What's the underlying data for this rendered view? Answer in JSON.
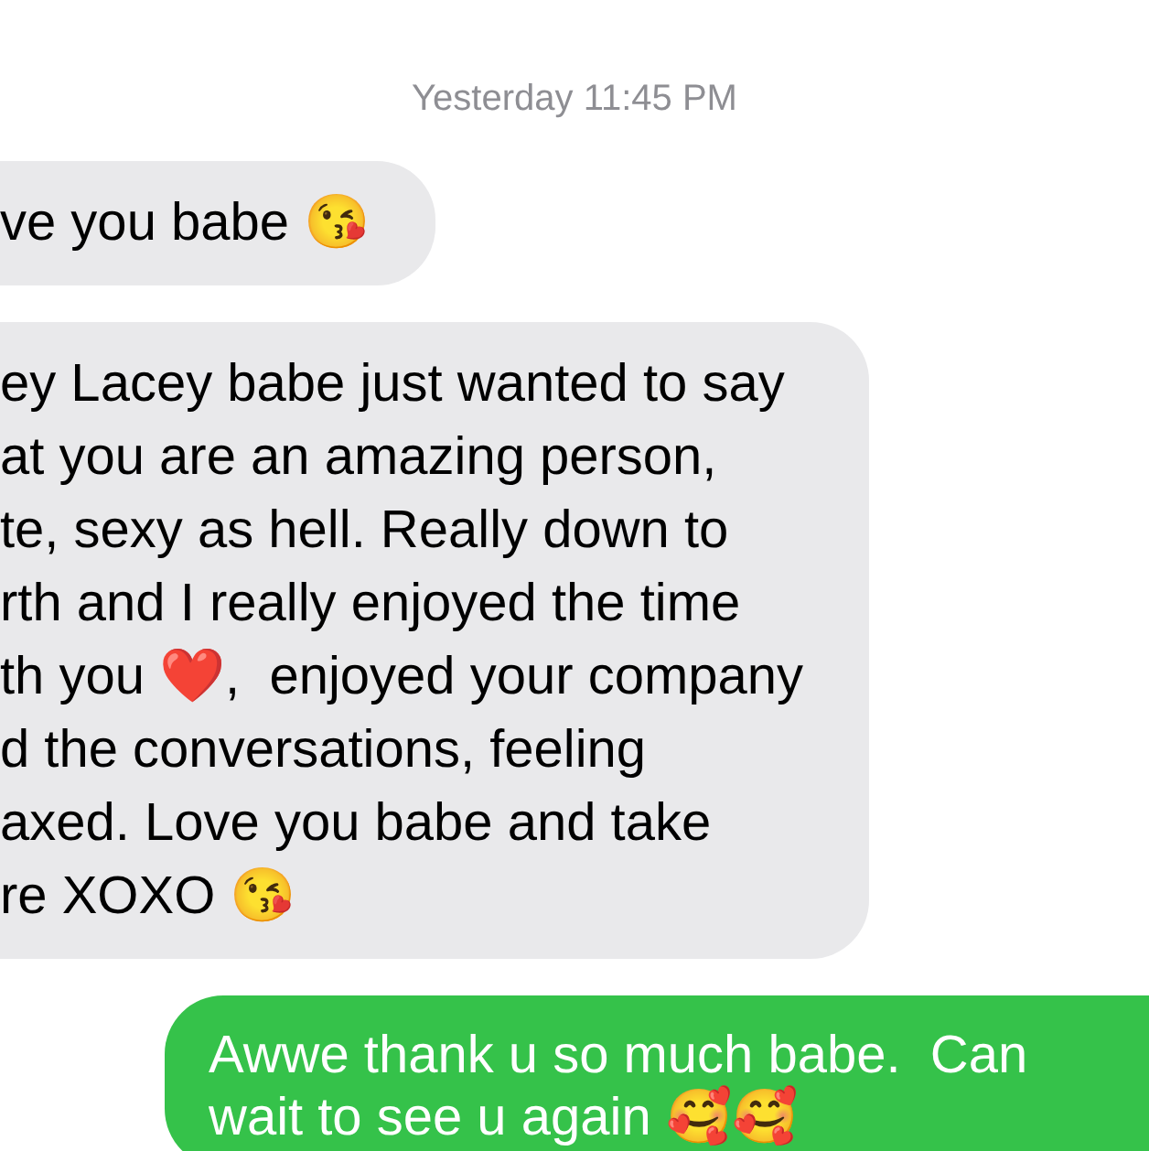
{
  "timestamp": "Yesterday 11:45 PM",
  "messages": [
    {
      "kind": "received",
      "lines": [
        "ve you babe 😘"
      ]
    },
    {
      "kind": "received",
      "lines": [
        "ey Lacey babe just wanted to say",
        "at you are an amazing person,",
        "te, sexy as hell. Really down to",
        "rth and I really enjoyed the time",
        "th you ❤️,  enjoyed your company",
        "d the conversations, feeling",
        "axed. Love you babe and take",
        "re XOXO 😘"
      ]
    },
    {
      "kind": "sent",
      "lines": [
        "Awwe thank u so much babe.  Can",
        "wait to see u again 🥰🥰"
      ]
    }
  ]
}
